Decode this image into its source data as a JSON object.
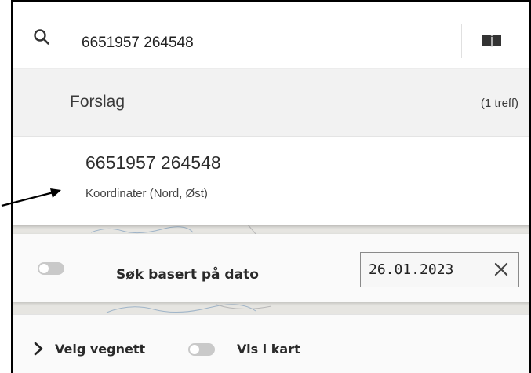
{
  "search": {
    "query": "6651957 264548",
    "placeholder": ""
  },
  "suggestions": {
    "title": "Forslag",
    "count": "(1 treff)",
    "items": [
      {
        "title": "6651957 264548",
        "subtitle": "Koordinater (Nord, Øst)"
      }
    ]
  },
  "date_filter": {
    "label": "Søk basert på dato",
    "value": "26.01.2023",
    "enabled": false
  },
  "network": {
    "select_label": "Velg vegnett",
    "show_in_map_label": "Vis i kart",
    "show_in_map_enabled": false
  },
  "icons": {
    "search": "search-icon",
    "book": "book-icon",
    "clear": "close-icon",
    "expand": "chevron-right-icon",
    "annotation": "arrow-icon"
  },
  "colors": {
    "panel_bg": "#ffffff",
    "header_bg": "#f2f2f2",
    "map_bg": "#e6e5e1",
    "toggle_off": "#c9c9c9"
  }
}
